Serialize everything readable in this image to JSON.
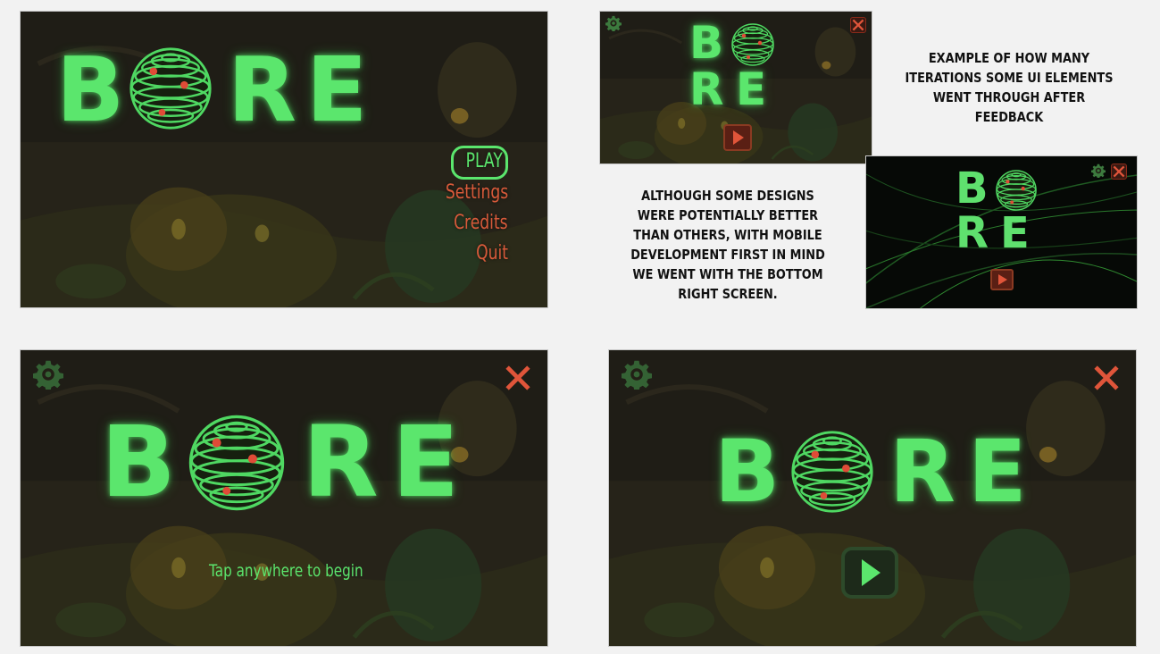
{
  "logo": {
    "letters": [
      "B",
      "O",
      "R",
      "E"
    ]
  },
  "panel1": {
    "menu": [
      "PLAY",
      "Settings",
      "Credits",
      "Quit"
    ]
  },
  "captions": {
    "top": "EXAMPLE OF HOW MANY ITERATIONS SOME UI ELEMENTS WENT THROUGH AFTER FEEDBACK",
    "bottom": "ALTHOUGH SOME DESIGNS WERE POTENTIALLY BETTER THAN OTHERS, WITH MOBILE DEVELOPMENT FIRST IN MIND WE WENT WITH THE BOTTOM RIGHT SCREEN."
  },
  "panel5": {
    "prompt": "Tap anywhere to begin"
  },
  "icons": {
    "settings": "gear-icon",
    "close": "close-icon",
    "play": "play-icon"
  },
  "colors": {
    "logo_green": "#5be66d",
    "accent_red": "#d85a3a",
    "page_bg": "#f2f2f2"
  }
}
